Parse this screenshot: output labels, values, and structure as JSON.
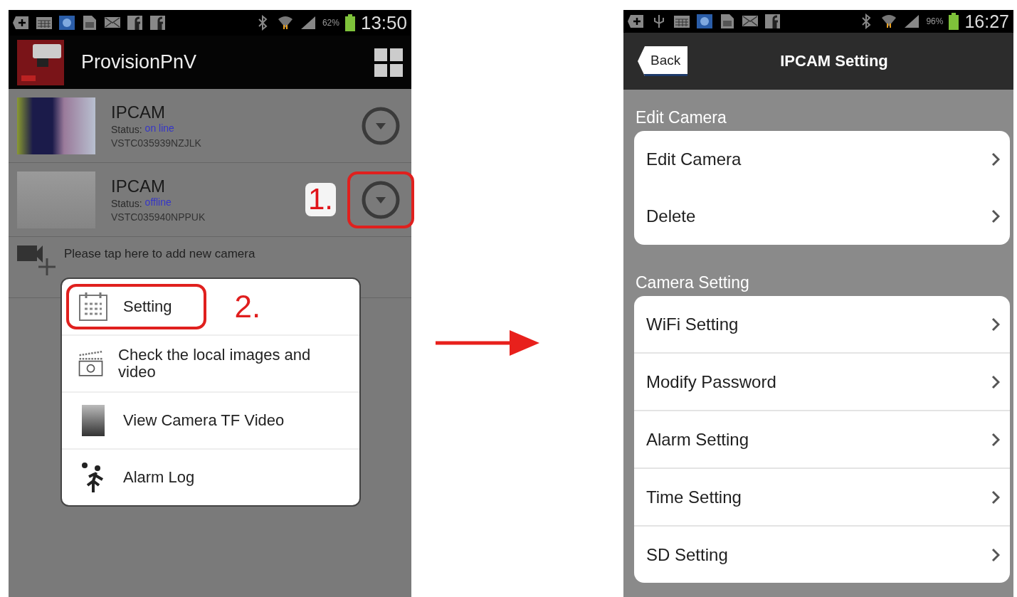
{
  "left_screen": {
    "status_bar": {
      "battery_text": "62%",
      "time": "13:50"
    },
    "app_bar": {
      "title": "ProvisionPnV"
    },
    "cameras": [
      {
        "name": "IPCAM",
        "status_label": "Status:",
        "status": "on line",
        "id": "VSTC035939NZJLK",
        "highlighted": false
      },
      {
        "name": "IPCAM",
        "status_label": "Status:",
        "status": "offline",
        "id": "VSTC035940NPPUK",
        "highlighted": true,
        "callout": "1."
      }
    ],
    "add_hint": "Please tap here to add new camera",
    "popup_menu": [
      {
        "label": "Setting",
        "highlighted": true,
        "callout": "2."
      },
      {
        "label": "Check the local images and video",
        "highlighted": false
      },
      {
        "label": "View Camera TF Video",
        "highlighted": false
      },
      {
        "label": "Alarm Log",
        "highlighted": false
      }
    ]
  },
  "right_screen": {
    "status_bar": {
      "battery_text": "96%",
      "time": "16:27"
    },
    "header": {
      "back": "Back",
      "title": "IPCAM Setting"
    },
    "sections": [
      {
        "title": "Edit Camera",
        "items": [
          {
            "label": "Edit Camera"
          },
          {
            "label": "Delete"
          }
        ]
      },
      {
        "title": "Camera Setting",
        "items": [
          {
            "label": "WiFi Setting"
          },
          {
            "label": "Modify Password"
          },
          {
            "label": "Alarm Setting"
          },
          {
            "label": "Time Setting"
          },
          {
            "label": "SD Setting"
          }
        ]
      }
    ]
  }
}
